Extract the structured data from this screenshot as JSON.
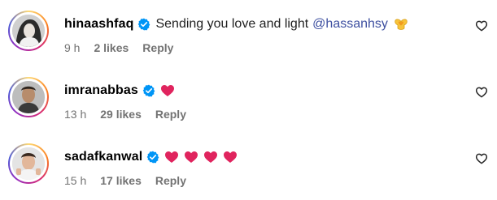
{
  "comments": [
    {
      "username": "hinaashfaq",
      "verified": true,
      "text": "Sending you love and light",
      "mention": "@hassanhsy",
      "emoji": [
        "heart-hands"
      ],
      "time": "9 h",
      "likes": "2 likes",
      "reply_label": "Reply"
    },
    {
      "username": "imranabbas",
      "verified": true,
      "text": "",
      "mention": "",
      "emoji": [
        "red-heart"
      ],
      "time": "13 h",
      "likes": "29 likes",
      "reply_label": "Reply"
    },
    {
      "username": "sadafkanwal",
      "verified": true,
      "text": "",
      "mention": "",
      "emoji": [
        "red-heart",
        "red-heart",
        "red-heart",
        "red-heart"
      ],
      "time": "15 h",
      "likes": "17 likes",
      "reply_label": "Reply"
    }
  ],
  "colors": {
    "mention": "#3d4fa0",
    "meta": "#737373",
    "verified": "#0095f6",
    "heart": "#e0245e"
  }
}
